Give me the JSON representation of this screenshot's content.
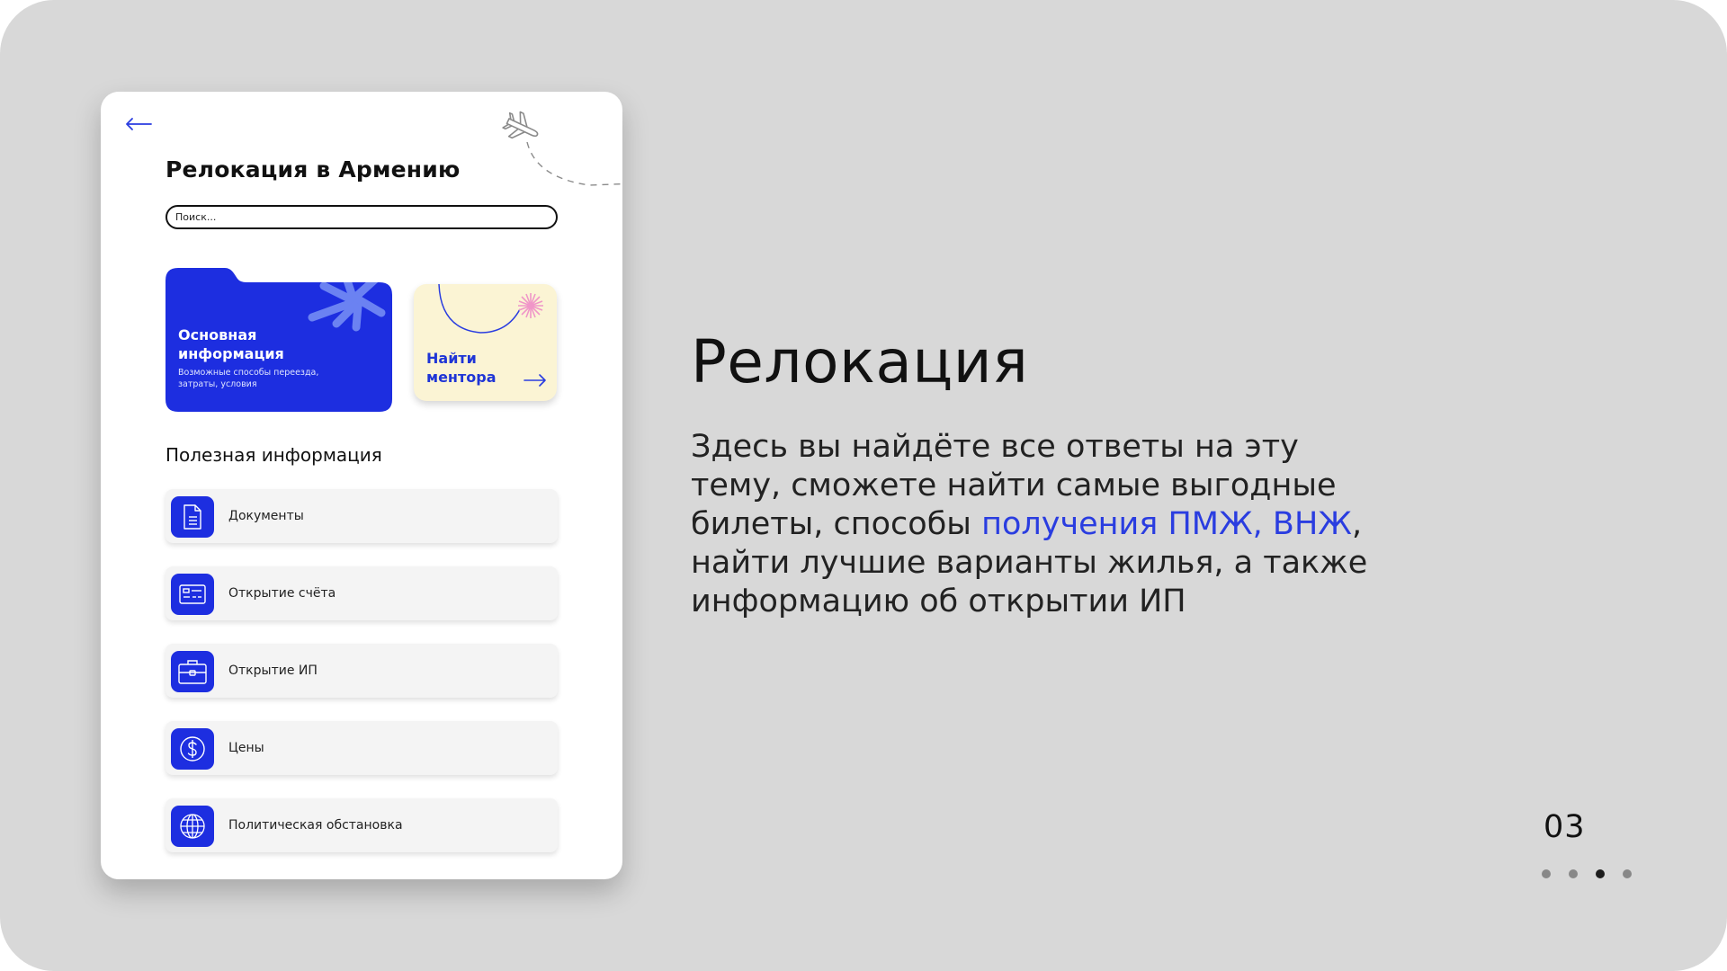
{
  "app": {
    "title": "Релокация в Армению",
    "search_placeholder": "Поиск...",
    "main_card": {
      "title": "Основная информация",
      "subtitle": "Возможные способы переезда, затраты, условия",
      "color": "#1d2ee0"
    },
    "mentor_card": {
      "title": "Найти ментора",
      "color": "#fbf4d4"
    },
    "section_title": "Полезная информация",
    "items": [
      {
        "label": "Документы",
        "icon": "document-icon"
      },
      {
        "label": "Открытие счёта",
        "icon": "bank-card-icon"
      },
      {
        "label": "Открытие ИП",
        "icon": "briefcase-icon"
      },
      {
        "label": "Цены",
        "icon": "dollar-icon"
      },
      {
        "label": "Политическая обстановка",
        "icon": "globe-icon"
      }
    ]
  },
  "slide": {
    "headline": "Релокация",
    "body_before": "Здесь вы найдёте все ответы на эту тему, сможете найти самые выгодные билеты, способы ",
    "body_highlight": "получения ПМЖ, ВНЖ",
    "body_after": ", найти лучшие варианты жилья, а также информацию об открытии ИП",
    "page_number": "03",
    "dots_total": 4,
    "dots_active_index": 2,
    "accent_color": "#2a3de0",
    "background_color": "#d8d8d8"
  }
}
